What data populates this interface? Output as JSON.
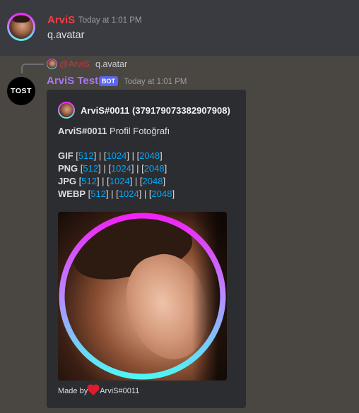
{
  "message1": {
    "author": "ArviS",
    "timestamp": "Today at 1:01 PM",
    "content": "q.avatar"
  },
  "reply": {
    "mention": "@ArviS",
    "content": "q.avatar"
  },
  "message2": {
    "author": "ArviS Test",
    "bot_tag": "BOT",
    "timestamp": "Today at 1:01 PM",
    "avatar_text": "TOST"
  },
  "embed": {
    "author": "ArviS#0011 (379179073382907908)",
    "title_bold": "ArviS#0011",
    "title_rest": " Profil Fotoğrafı",
    "formats": [
      {
        "name": "GIF",
        "sizes": [
          "512",
          "1024",
          "2048"
        ]
      },
      {
        "name": "PNG",
        "sizes": [
          "512",
          "1024",
          "2048"
        ]
      },
      {
        "name": "JPG",
        "sizes": [
          "512",
          "1024",
          "2048"
        ]
      },
      {
        "name": "WEBP",
        "sizes": [
          "512",
          "1024",
          "2048"
        ]
      }
    ],
    "footer_prefix": "Made by",
    "footer_user": "ArviS#0011"
  },
  "colors": {
    "author_red": "#f23f43",
    "bot_name": "#a678f5",
    "link": "#00a8fc",
    "bot_tag": "#5865f2",
    "ring_top": "#f023f7",
    "ring_bottom": "#4ef6f6"
  }
}
